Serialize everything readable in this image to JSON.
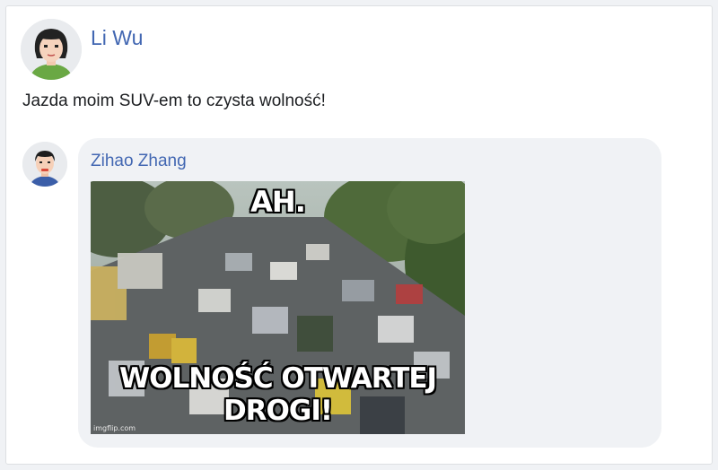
{
  "post": {
    "author": "Li Wu",
    "text": "Jazda moim SUV-em to czysta wolność!"
  },
  "comment": {
    "author": "Zihao Zhang",
    "meme": {
      "top_text": "AH.",
      "bottom_text": "WOLNOŚĆ OTWARTEJ DROGI!",
      "watermark": "imgflip.com",
      "scene": "traffic-jam-photo"
    }
  },
  "colors": {
    "page_background": "#f0f2f5",
    "card_background": "#ffffff",
    "name_link": "#4267b2",
    "bubble_background": "#f0f2f5",
    "text": "#1c1e21"
  }
}
